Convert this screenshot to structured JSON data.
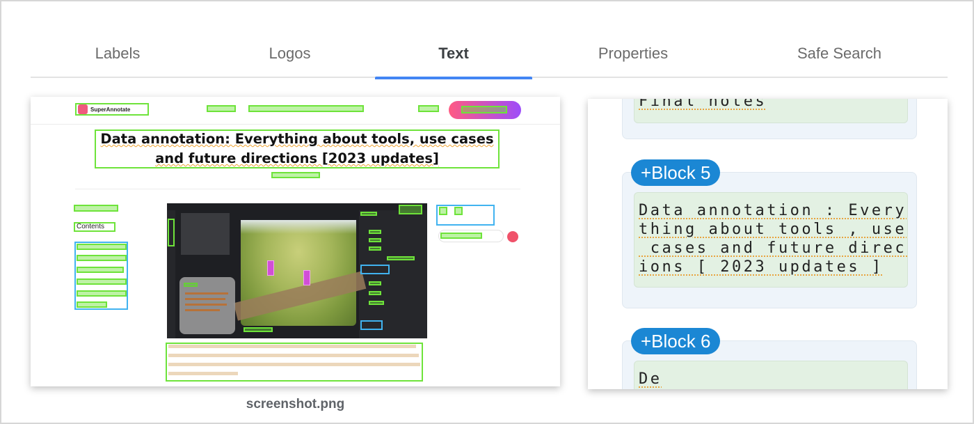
{
  "tabs": [
    {
      "label": "Labels",
      "active": false
    },
    {
      "label": "Logos",
      "active": false
    },
    {
      "label": "Text",
      "active": true
    },
    {
      "label": "Properties",
      "active": false
    },
    {
      "label": "Safe Search",
      "active": false
    }
  ],
  "preview": {
    "filename": "screenshot.png",
    "site": {
      "logo_text": "SuperAnnotate",
      "headline_line1": "Data annotation: Everything about tools, use cases",
      "headline_line2": "and future directions [2023 updates]",
      "toc_heading": "Contents"
    }
  },
  "blocks": [
    {
      "label": "",
      "text_lines": [
        "Final notes"
      ]
    },
    {
      "label": "+Block 5",
      "text_lines": [
        "Data annotation : Every",
        "thing about tools , use",
        " cases and future direct",
        "ions [ 2023 updates ]"
      ]
    },
    {
      "label": "+Block 6",
      "text_lines": [
        "De"
      ]
    }
  ],
  "colors": {
    "accent": "#4285f4",
    "block_pill": "#1b87d4",
    "detection_box": "#6ee33a",
    "detection_box_alt": "#41b3f0"
  }
}
